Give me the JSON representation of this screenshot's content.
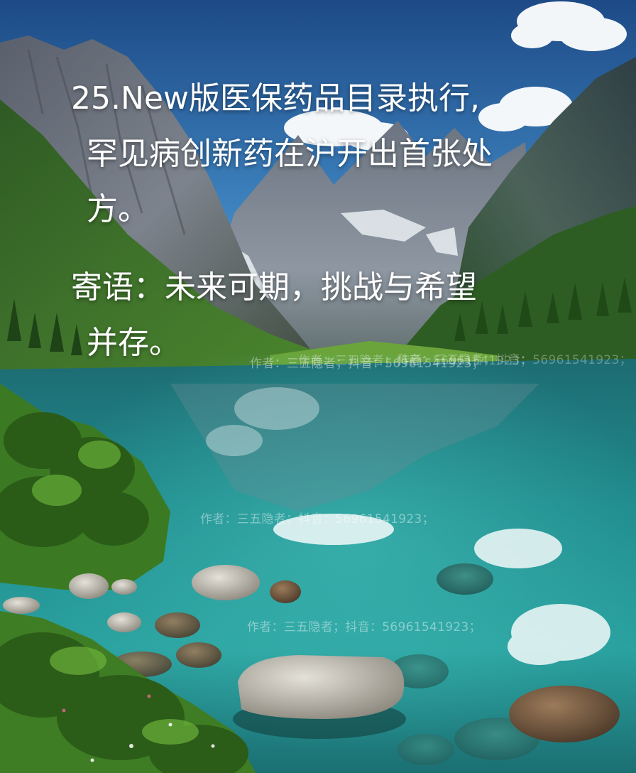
{
  "image": {
    "description_colors": {
      "sky_top": "#1f4f8c",
      "sky_bottom": "#4a90c8",
      "mountain_dark": "#3c4452",
      "mountain_light": "#8d939c",
      "forest": "#2e5a24",
      "lake_deep": "#0f5c63",
      "lake_shallow": "#2aa3a0",
      "rock": "#c9c6bc"
    }
  },
  "headline": {
    "line1": "25.New版医保药品目录执行,",
    "line2": "罕见病创新药在沪开出首张处方。"
  },
  "message": {
    "line1": "寄语：未来可期，挑战与希望",
    "line2": "并存。"
  },
  "watermarks": {
    "wm1": "作者：三五隐者；抖音：56961541923；",
    "wm2": "作者：三五隐者；抖音：56961541923；",
    "wm3": "作者：三五隐者；抖音：56961541923；",
    "wm4": "作者：三五隐者；抖音：56961541923；",
    "wm5": "作者：三五隐者；抖音：56961541923；"
  }
}
